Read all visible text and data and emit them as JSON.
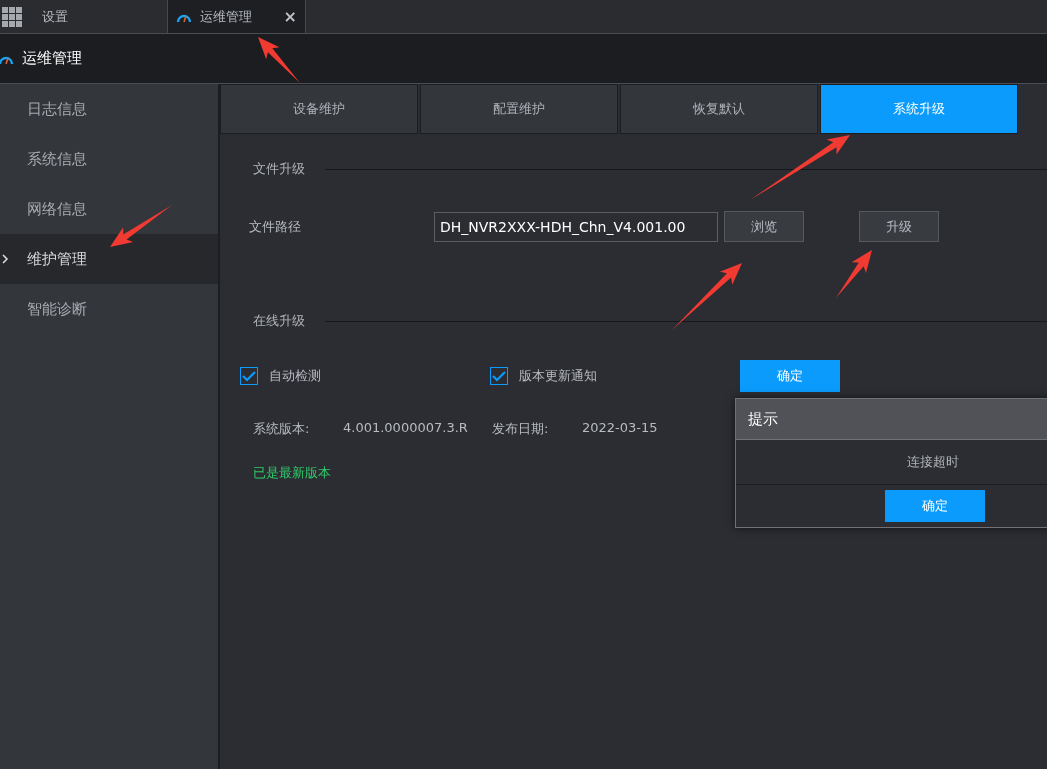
{
  "top_tabs": [
    {
      "label": "设置",
      "kind": "home",
      "selected": false
    },
    {
      "label": "运维管理",
      "kind": "page",
      "selected": true,
      "close": "×"
    }
  ],
  "header": {
    "title": "运维管理"
  },
  "sidebar": {
    "items": [
      {
        "label": "日志信息",
        "selected": false
      },
      {
        "label": "系统信息",
        "selected": false
      },
      {
        "label": "网络信息",
        "selected": false
      },
      {
        "label": "维护管理",
        "selected": true
      },
      {
        "label": "智能诊断",
        "selected": false
      }
    ]
  },
  "tabs": [
    {
      "label": "设备维护",
      "selected": false
    },
    {
      "label": "配置维护",
      "selected": false
    },
    {
      "label": "恢复默认",
      "selected": false
    },
    {
      "label": "系统升级",
      "selected": true
    }
  ],
  "file_upgrade": {
    "title": "文件升级",
    "path_label": "文件路径",
    "path_value": "DH_NVR2XXX-HDH_Chn_V4.001.00",
    "browse_button": "浏览",
    "upgrade_button": "升级"
  },
  "online_upgrade": {
    "title": "在线升级",
    "checkboxes": [
      {
        "label": "自动检测",
        "checked": true
      },
      {
        "label": "版本更新通知",
        "checked": true
      }
    ],
    "confirm_button": "确定",
    "version_label": "系统版本:",
    "version_value": "4.001.0000007.3.R",
    "date_label": "发布日期:",
    "date_value": "2022-03-15",
    "status": "已是最新版本"
  },
  "dialog": {
    "title": "提示",
    "message": "连接超时",
    "button": "确定"
  }
}
